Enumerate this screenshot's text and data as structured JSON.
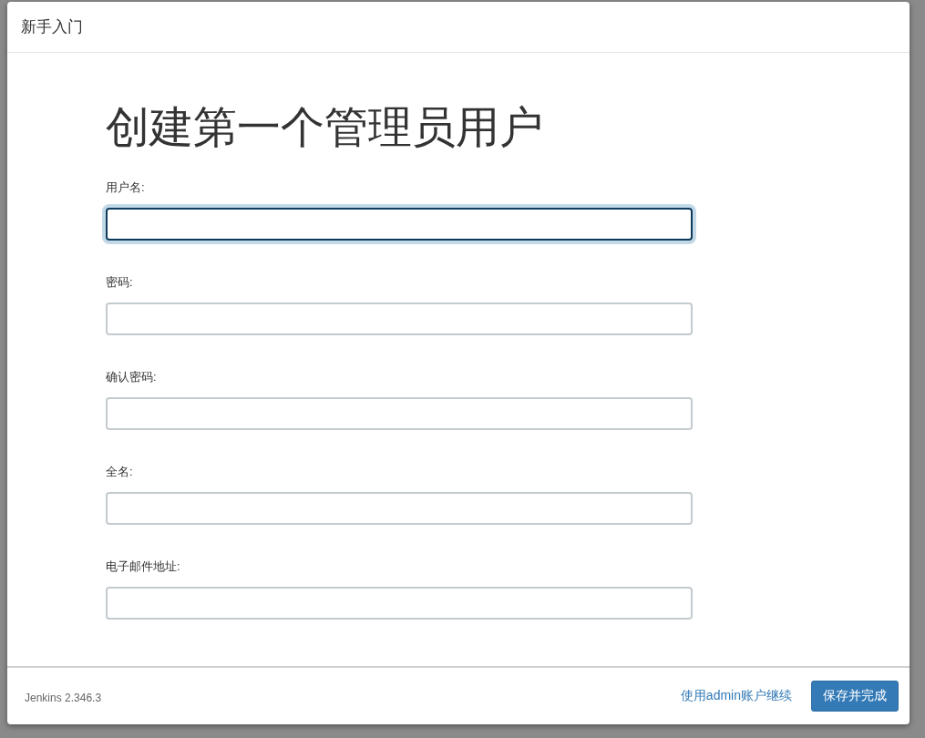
{
  "dialog": {
    "title": "新手入门"
  },
  "heading": "创建第一个管理员用户",
  "fields": [
    {
      "label": "用户名:",
      "focused": true
    },
    {
      "label": "密码:",
      "focused": false
    },
    {
      "label": "确认密码:",
      "focused": false
    },
    {
      "label": "全名:",
      "focused": false
    },
    {
      "label": "电子邮件地址:",
      "focused": false
    }
  ],
  "footer": {
    "version": "Jenkins 2.346.3",
    "link": "使用admin账户继续",
    "button": "保存并完成"
  }
}
